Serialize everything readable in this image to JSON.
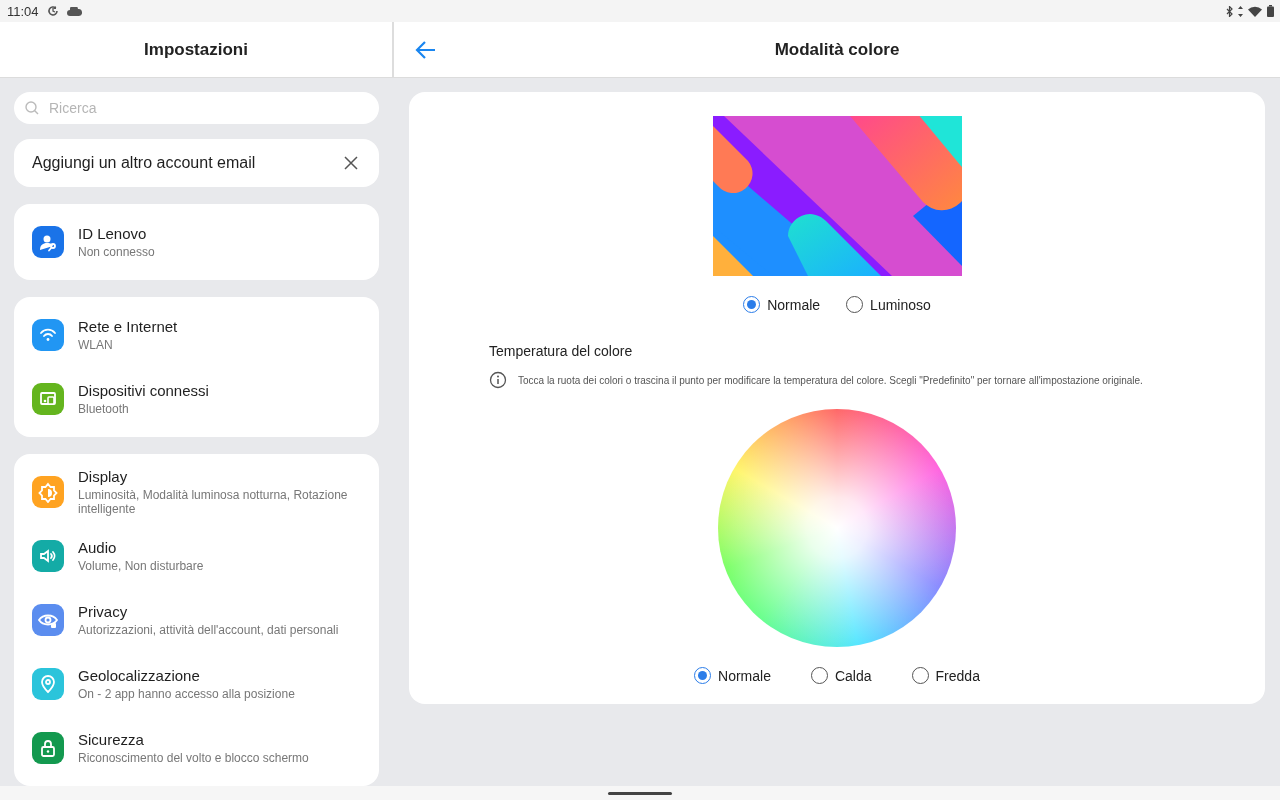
{
  "status_bar": {
    "time": "11:04"
  },
  "sidebar": {
    "title": "Impostazioni",
    "search": {
      "placeholder": "Ricerca"
    },
    "suggestion": {
      "text": "Aggiungi un altro account email"
    },
    "groups": [
      [
        {
          "title": "ID Lenovo",
          "subtitle": "Non connesso",
          "kind": "person",
          "color": "#1a73e8"
        }
      ],
      [
        {
          "title": "Rete e Internet",
          "subtitle": "WLAN",
          "kind": "wifi",
          "color": "#2196f3"
        },
        {
          "title": "Dispositivi connessi",
          "subtitle": "Bluetooth",
          "kind": "devices",
          "color": "#64b51e"
        }
      ],
      [
        {
          "title": "Display",
          "subtitle": "Luminosità, Modalità luminosa notturna, Rotazione intelligente",
          "kind": "brightness",
          "color": "#ffa321"
        },
        {
          "title": "Audio",
          "subtitle": "Volume, Non disturbare",
          "kind": "speaker",
          "color": "#14aba6"
        },
        {
          "title": "Privacy",
          "subtitle": "Autorizzazioni, attività dell'account, dati personali",
          "kind": "eye",
          "color": "#5b8def"
        },
        {
          "title": "Geolocalizzazione",
          "subtitle": "On - 2 app hanno accesso alla posizione",
          "kind": "pin",
          "color": "#2bc4db"
        },
        {
          "title": "Sicurezza",
          "subtitle": "Riconoscimento del volto e blocco schermo",
          "kind": "lock",
          "color": "#13994f"
        }
      ]
    ]
  },
  "detail": {
    "title": "Modalità colore",
    "modes": [
      {
        "label": "Normale",
        "selected": true
      },
      {
        "label": "Luminoso",
        "selected": false
      }
    ],
    "temperature": {
      "title": "Temperatura del colore",
      "hint": "Tocca la ruota dei colori o trascina il punto per modificare la temperatura del colore. Scegli \"Predefinito\" per tornare all'impostazione originale.",
      "options": [
        {
          "label": "Normale",
          "selected": true
        },
        {
          "label": "Calda",
          "selected": false
        },
        {
          "label": "Fredda",
          "selected": false
        }
      ]
    }
  }
}
